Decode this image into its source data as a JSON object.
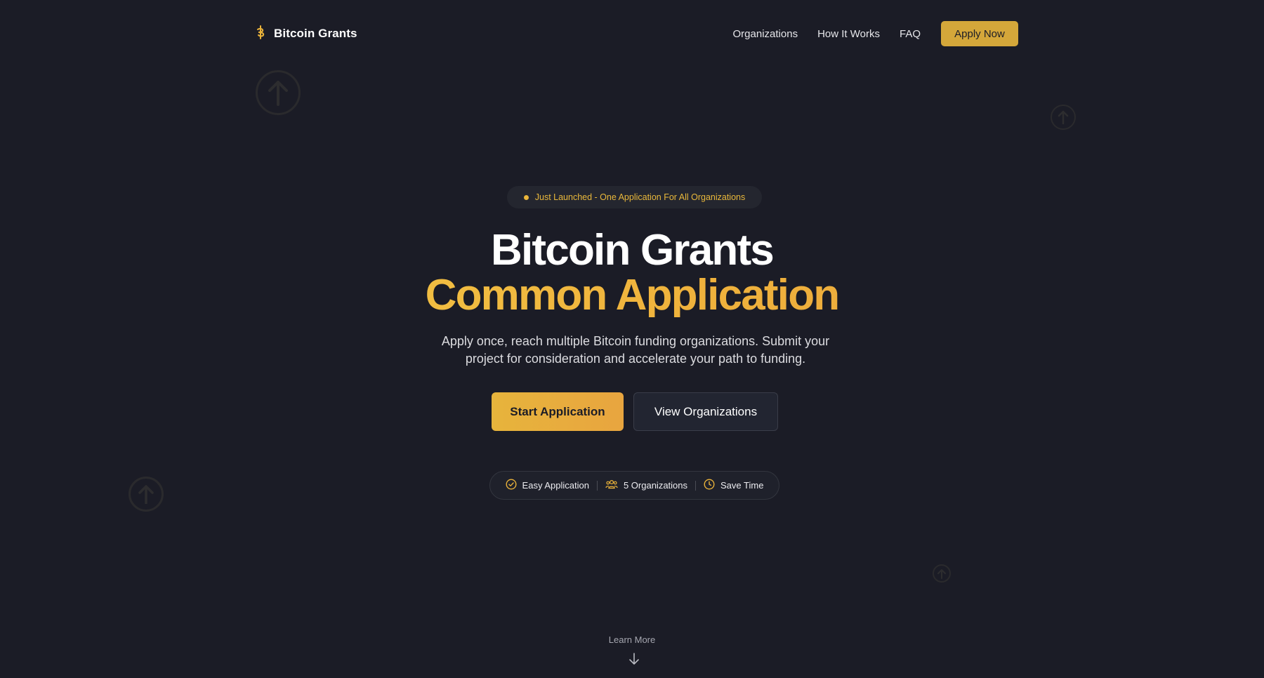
{
  "brand": {
    "name": "Bitcoin Grants",
    "logo_icon": "bitcoin-icon",
    "accent": "#d4a73a"
  },
  "nav": {
    "links": [
      "Organizations",
      "How It Works",
      "FAQ"
    ],
    "apply_label": "Apply Now"
  },
  "hero": {
    "badge": "Just Launched - One Application For All Organizations",
    "title_line1": "Bitcoin Grants",
    "title_line2": "Common Application",
    "subtitle": "Apply once, reach multiple Bitcoin funding organizations. Submit your project for consideration and accelerate your path to funding.",
    "primary_cta": "Start Application",
    "secondary_cta": "View Organizations"
  },
  "features": [
    {
      "icon": "check-circle-icon",
      "label": "Easy Application"
    },
    {
      "icon": "users-icon",
      "label": "5 Organizations"
    },
    {
      "icon": "clock-icon",
      "label": "Save Time"
    }
  ],
  "footer_hint": {
    "label": "Learn More",
    "icon": "arrow-down-icon"
  },
  "colors": {
    "background": "#1b1c26",
    "gold": "#e9b83b",
    "gold_light": "#f5cf4a",
    "gold_dark": "#e8a23a"
  }
}
